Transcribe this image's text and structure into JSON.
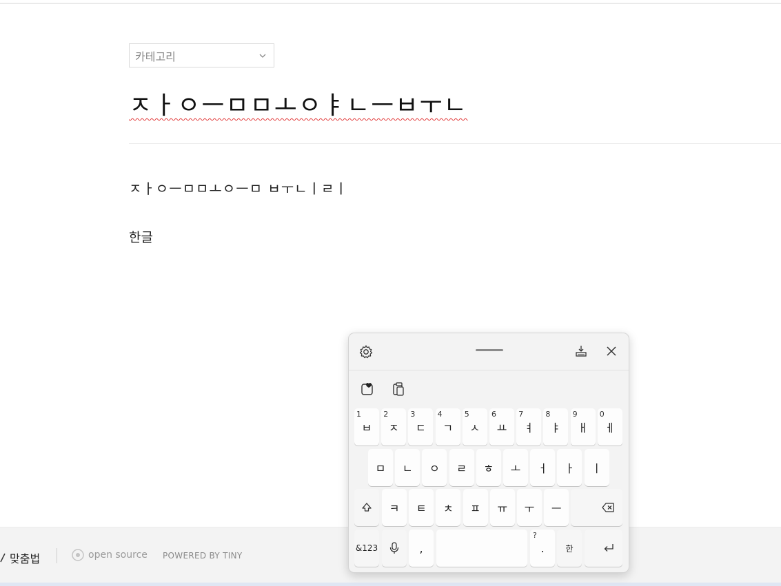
{
  "editor": {
    "category_label": "카테고리",
    "title": "ㅈㅏㅇㅡㅁㅁㅗㅇㅑㄴㅡㅂㅜㄴ",
    "body_line1": "ㅈㅏㅇㅡㅁㅁㅗㅇㅡㅁ ㅂㅜㄴㅣㄹㅣ",
    "body_line2": "한글"
  },
  "footer": {
    "spellcheck_label": "맞춤법",
    "opensource_label": "open source",
    "powered_label": "POWERED BY TINY"
  },
  "keyboard": {
    "row1": [
      {
        "num": "1",
        "ch": "ㅂ"
      },
      {
        "num": "2",
        "ch": "ㅈ"
      },
      {
        "num": "3",
        "ch": "ㄷ"
      },
      {
        "num": "4",
        "ch": "ㄱ"
      },
      {
        "num": "5",
        "ch": "ㅅ"
      },
      {
        "num": "6",
        "ch": "ㅛ"
      },
      {
        "num": "7",
        "ch": "ㅕ"
      },
      {
        "num": "8",
        "ch": "ㅑ"
      },
      {
        "num": "9",
        "ch": "ㅐ"
      },
      {
        "num": "0",
        "ch": "ㅔ"
      }
    ],
    "row2": [
      "ㅁ",
      "ㄴ",
      "ㅇ",
      "ㄹ",
      "ㅎ",
      "ㅗ",
      "ㅓ",
      "ㅏ",
      "ㅣ"
    ],
    "row3": [
      "ㅋ",
      "ㅌ",
      "ㅊ",
      "ㅍ",
      "ㅠ",
      "ㅜ",
      "ㅡ"
    ],
    "symbols_label": "&123",
    "comma_label": ",",
    "period_label": ".",
    "period_sup": "?",
    "lang_label": "한"
  }
}
